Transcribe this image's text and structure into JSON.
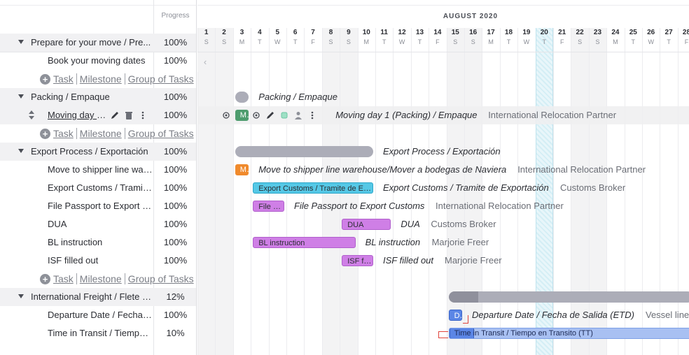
{
  "left_header": {
    "progress_label": "Progress"
  },
  "timeline": {
    "month_label": "AUGUST 2020",
    "today_day": 20
  },
  "days": [
    {
      "n": "1",
      "l": "S",
      "weekend": true
    },
    {
      "n": "2",
      "l": "S",
      "weekend": true
    },
    {
      "n": "3",
      "l": "M"
    },
    {
      "n": "4",
      "l": "T"
    },
    {
      "n": "5",
      "l": "W"
    },
    {
      "n": "6",
      "l": "T"
    },
    {
      "n": "7",
      "l": "F"
    },
    {
      "n": "8",
      "l": "S",
      "weekend": true
    },
    {
      "n": "9",
      "l": "S",
      "weekend": true
    },
    {
      "n": "10",
      "l": "M"
    },
    {
      "n": "11",
      "l": "T"
    },
    {
      "n": "12",
      "l": "W"
    },
    {
      "n": "13",
      "l": "T"
    },
    {
      "n": "14",
      "l": "F"
    },
    {
      "n": "15",
      "l": "S",
      "weekend": true
    },
    {
      "n": "16",
      "l": "S",
      "weekend": true
    },
    {
      "n": "17",
      "l": "M"
    },
    {
      "n": "18",
      "l": "T"
    },
    {
      "n": "19",
      "l": "W"
    },
    {
      "n": "20",
      "l": "T"
    },
    {
      "n": "21",
      "l": "F"
    },
    {
      "n": "22",
      "l": "S",
      "weekend": true
    },
    {
      "n": "23",
      "l": "S",
      "weekend": true
    },
    {
      "n": "24",
      "l": "M"
    },
    {
      "n": "25",
      "l": "T"
    },
    {
      "n": "26",
      "l": "W"
    },
    {
      "n": "27",
      "l": "T"
    },
    {
      "n": "28",
      "l": "F"
    }
  ],
  "add_links": {
    "task": "Task",
    "milestone": "Milestone",
    "group": "Group of Tasks"
  },
  "rows": [
    {
      "type": "group",
      "name": "Prepare for your move / Pre...",
      "progress": "100%"
    },
    {
      "type": "task",
      "name": "Book your moving dates",
      "progress": "100%"
    },
    {
      "type": "add"
    },
    {
      "type": "group",
      "name": "Packing / Empaque",
      "progress": "100%",
      "bar": {
        "kind": "group",
        "start": 3,
        "end": 4,
        "label": "Packing / Empaque"
      }
    },
    {
      "type": "task-hover",
      "name": "Moving day 1...",
      "progress": "100%",
      "bar": {
        "kind": "milestone-green",
        "start": 3,
        "end": 4,
        "text": "M...",
        "label": "Moving day 1 (Packing) / Empaque",
        "assignee": "International Relocation Partner"
      }
    },
    {
      "type": "add"
    },
    {
      "type": "group",
      "name": "Export Process / Exportación",
      "progress": "100%",
      "bar": {
        "kind": "group",
        "start": 3,
        "end": 11,
        "label": "Export Process / Exportación"
      }
    },
    {
      "type": "task",
      "name": "Move to shipper line war...",
      "progress": "100%",
      "bar": {
        "kind": "milestone-orange",
        "start": 3,
        "end": 4,
        "text": "M...",
        "label": "Move to shipper line warehouse/Mover a bodegas de Naviera",
        "assignee": "International Relocation Partner"
      }
    },
    {
      "type": "task",
      "name": "Export Customs / Tramit...",
      "progress": "100%",
      "bar": {
        "kind": "cyan",
        "start": 4,
        "end": 11,
        "text": "Export Customs / Tramite de Expor...",
        "label": "Export Customs / Tramite de Exportación",
        "assignee": "Customs Broker"
      }
    },
    {
      "type": "task",
      "name": "File Passport to Export C...",
      "progress": "100%",
      "bar": {
        "kind": "purple",
        "start": 4,
        "end": 6,
        "text": "File P...",
        "label": "File Passport to Export Customs",
        "assignee": "International Relocation Partner"
      }
    },
    {
      "type": "task",
      "name": "DUA",
      "progress": "100%",
      "bar": {
        "kind": "purple",
        "start": 9,
        "end": 12,
        "text": "DUA",
        "label": "DUA",
        "assignee": "Customs Broker"
      }
    },
    {
      "type": "task",
      "name": "BL instruction",
      "progress": "100%",
      "bar": {
        "kind": "purple",
        "start": 4,
        "end": 10,
        "text": "BL instruction",
        "label": "BL instruction",
        "assignee": "Marjorie Freer"
      }
    },
    {
      "type": "task",
      "name": "ISF filled out",
      "progress": "100%",
      "bar": {
        "kind": "purple",
        "start": 9,
        "end": 11,
        "text": "ISF fil...",
        "label": "ISF filled out",
        "assignee": "Marjorie Freer"
      }
    },
    {
      "type": "add"
    },
    {
      "type": "group",
      "name": "International Freight / Flete i...",
      "progress": "12%",
      "bar": {
        "kind": "group-progress",
        "start": 15,
        "end": 29,
        "fill": 0.12
      }
    },
    {
      "type": "task",
      "name": "Departure Date / Fecha ...",
      "progress": "100%",
      "bar": {
        "kind": "blue",
        "start": 15,
        "end": 16,
        "text": "D...",
        "label": "Departure Date / Fecha de Salida (ETD)",
        "assignee": "Vessel line/..."
      }
    },
    {
      "type": "task",
      "name": "Time in Transit / Tiempo ...",
      "progress": "10%",
      "bar": {
        "kind": "blue-split",
        "start": 15,
        "end": 29,
        "text": "Time in Transit / Tiempo en Transito (TT)",
        "fill": 0.1
      }
    }
  ]
}
